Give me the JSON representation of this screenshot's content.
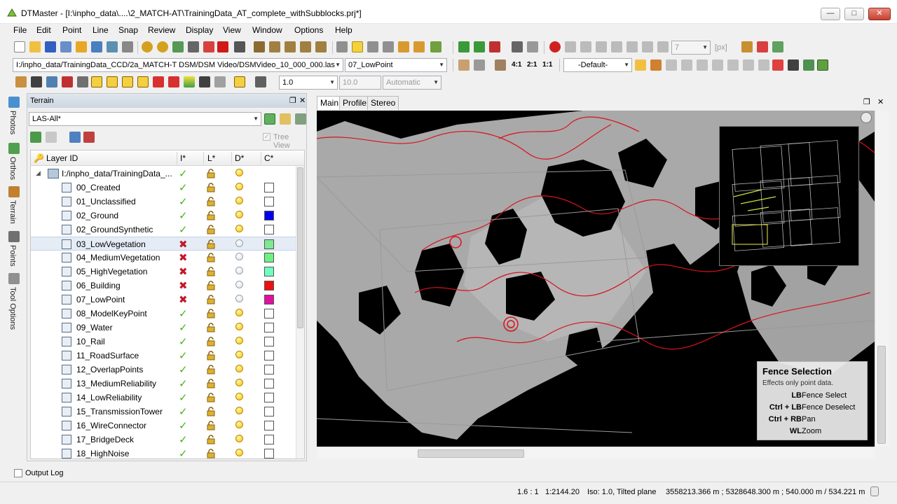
{
  "window": {
    "title": "DTMaster - [I:\\inpho_data\\....\\2_MATCH-AT\\TrainingData_AT_complete_withSubblocks.prj*]",
    "min": "—",
    "max": "□",
    "close": "✕"
  },
  "menu": [
    "File",
    "Edit",
    "Point",
    "Line",
    "Snap",
    "Review",
    "Display",
    "View",
    "Window",
    "Options",
    "Help"
  ],
  "toolbar": {
    "file_path": "I:/inpho_data/TrainingData_CCD/2a_MATCH-T DSM/DSM Video/DSMVideo_10_000_000.las",
    "layer_select": "07_LowPoint",
    "zoom_41": "4:1",
    "zoom_21": "2:1",
    "zoom_11": "1:1",
    "view_mode": "-Default-",
    "step_value": "7",
    "step_unit": "[px]",
    "scale_value": "1.0",
    "tol_value": "10.0",
    "auto_mode": "Automatic"
  },
  "left_tabs": [
    "Photos",
    "Orthos",
    "Terrain",
    "Points",
    "Tool Options"
  ],
  "terrain_panel": {
    "title": "Terrain",
    "filter": "LAS-All*",
    "tree_view_label": "Tree View",
    "columns": [
      "Layer ID",
      "I*",
      "L*",
      "D*",
      "C*"
    ],
    "root": "I:/inpho_data/TrainingData_...",
    "layers": [
      {
        "name": "00_Created",
        "import": "ok",
        "display": "on",
        "color": "#ffffff"
      },
      {
        "name": "01_Unclassified",
        "import": "ok",
        "display": "on",
        "color": "#ffffff"
      },
      {
        "name": "02_Ground",
        "import": "ok",
        "display": "on",
        "color": "#0000ee"
      },
      {
        "name": "02_GroundSynthetic",
        "import": "ok",
        "display": "on",
        "color": "#ffffff"
      },
      {
        "name": "03_LowVegetation",
        "import": "no",
        "display": "off",
        "color": "#80e890",
        "selected": true
      },
      {
        "name": "04_MediumVegetation",
        "import": "no",
        "display": "off",
        "color": "#70f080"
      },
      {
        "name": "05_HighVegetation",
        "import": "no",
        "display": "off",
        "color": "#70ffc0"
      },
      {
        "name": "06_Building",
        "import": "no",
        "display": "off",
        "color": "#ee1010"
      },
      {
        "name": "07_LowPoint",
        "import": "no",
        "display": "off",
        "color": "#e010a0"
      },
      {
        "name": "08_ModelKeyPoint",
        "import": "ok",
        "display": "on",
        "color": "#ffffff"
      },
      {
        "name": "09_Water",
        "import": "ok",
        "display": "on",
        "color": "#ffffff"
      },
      {
        "name": "10_Rail",
        "import": "ok",
        "display": "on",
        "color": "#ffffff"
      },
      {
        "name": "11_RoadSurface",
        "import": "ok",
        "display": "on",
        "color": "#ffffff"
      },
      {
        "name": "12_OverlapPoints",
        "import": "ok",
        "display": "on",
        "color": "#ffffff"
      },
      {
        "name": "13_MediumReliability",
        "import": "ok",
        "display": "on",
        "color": "#ffffff"
      },
      {
        "name": "14_LowReliability",
        "import": "ok",
        "display": "on",
        "color": "#ffffff"
      },
      {
        "name": "15_TransmissionTower",
        "import": "ok",
        "display": "on",
        "color": "#ffffff"
      },
      {
        "name": "16_WireConnector",
        "import": "ok",
        "display": "on",
        "color": "#ffffff"
      },
      {
        "name": "17_BridgeDeck",
        "import": "ok",
        "display": "on",
        "color": "#ffffff"
      },
      {
        "name": "18_HighNoise",
        "import": "ok",
        "display": "on",
        "color": "#ffffff"
      }
    ]
  },
  "view_tabs": [
    "Main",
    "Profile",
    "Stereo"
  ],
  "tooltip": {
    "title": "Fence Selection",
    "subtitle": "Effects only point data.",
    "rows": [
      {
        "key": "LB",
        "action": "Fence Select"
      },
      {
        "key": "Ctrl + LB",
        "action": "Fence Deselect"
      },
      {
        "key": "Ctrl + RB",
        "action": "Pan"
      },
      {
        "key": "WL",
        "action": "Zoom"
      }
    ]
  },
  "output_log": "Output Log",
  "status": {
    "zoom": "1.6 : 1",
    "scale": "1:2144.20",
    "iso": "Iso: 1.0, Tilted plane",
    "coords": "3558213.366 m ; 5328648.300 m ; 540.000 m / 534.221 m"
  },
  "glyphs": {
    "check": "✓",
    "cross": "✖",
    "caret": "▼",
    "expand": "◢"
  }
}
